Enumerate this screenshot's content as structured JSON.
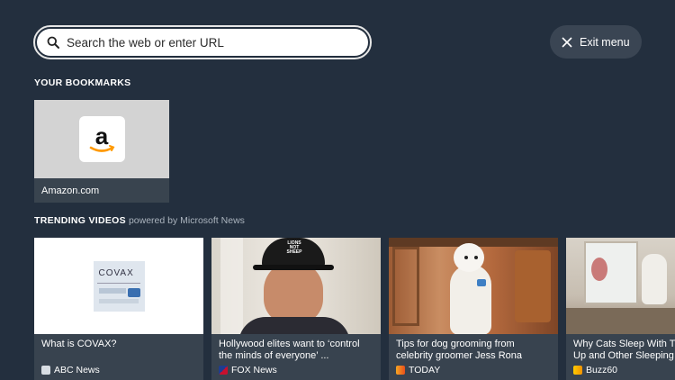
{
  "search": {
    "placeholder": "Search the web or enter URL",
    "icon": "search-icon"
  },
  "exit": {
    "label": "Exit menu",
    "icon": "close-icon"
  },
  "bookmarks": {
    "heading": "YOUR BOOKMARKS",
    "items": [
      {
        "label": "Amazon.com",
        "icon": "amazon-logo"
      }
    ]
  },
  "trending": {
    "heading": "TRENDING VIDEOS",
    "powered_by": "powered by Microsoft News",
    "videos": [
      {
        "title": "What is COVAX?",
        "source": "ABC News",
        "thumb_text": "COVAX"
      },
      {
        "title": "Hollywood elites want to ‘control the minds of everyone’ ...",
        "source": "FOX News",
        "thumb_text": "LIONS NOT SHEEP"
      },
      {
        "title": "Tips for dog grooming from celebrity groomer Jess Rona",
        "source": "TODAY"
      },
      {
        "title": "Why Cats Sleep With Their Up and Other Sleeping",
        "source": "Buzz60"
      }
    ]
  },
  "colors": {
    "background": "#232f3e",
    "card_info": "#38434f",
    "button": "#3a4553",
    "amazon_orange": "#ff9900"
  }
}
